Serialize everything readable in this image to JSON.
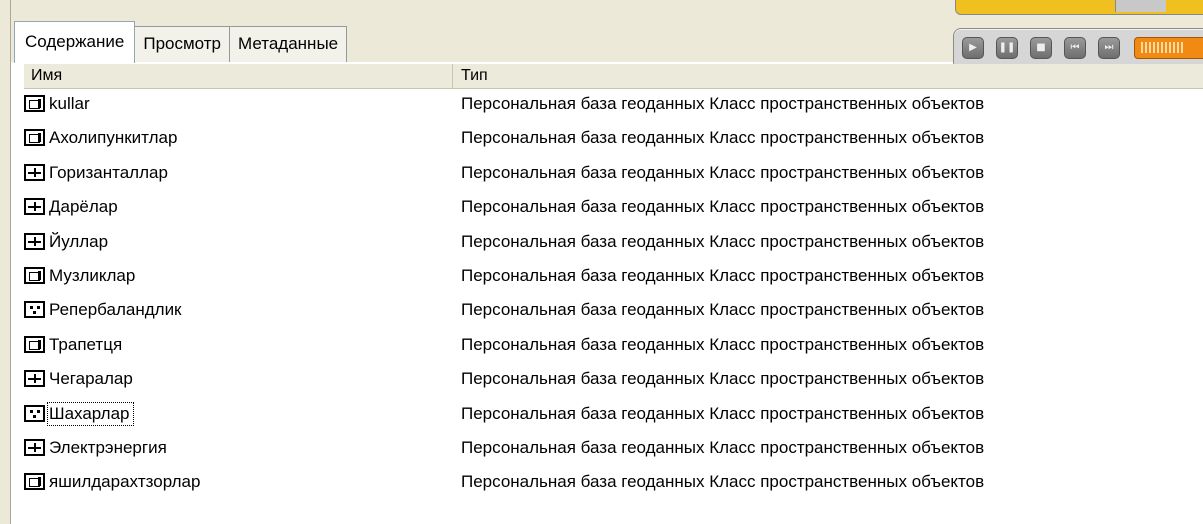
{
  "tabs": [
    {
      "label": "Содержание",
      "active": true
    },
    {
      "label": "Просмотр",
      "active": false
    },
    {
      "label": "Метаданные",
      "active": false
    }
  ],
  "media": {
    "buttons": [
      {
        "icon": "play-icon",
        "glyph": "▶"
      },
      {
        "icon": "pause-icon",
        "glyph": "❚❚"
      },
      {
        "icon": "stop-icon",
        "glyph": "■"
      },
      {
        "icon": "previous-icon",
        "glyph": "⏮"
      },
      {
        "icon": "next-icon",
        "glyph": "⏭"
      }
    ],
    "accent_color": "#f08a12"
  },
  "columns": {
    "name": "Имя",
    "type": "Тип"
  },
  "rows": [
    {
      "icon": "polygon-feature-class-icon",
      "kind": "poly",
      "name": "kullar",
      "type": "Персональная база геоданных Класс пространственных объектов"
    },
    {
      "icon": "polygon-feature-class-icon",
      "kind": "poly",
      "name": "Ахолипункитлар",
      "type": "Персональная база геоданных Класс пространственных объектов"
    },
    {
      "icon": "line-feature-class-icon",
      "kind": "line",
      "name": "Горизанталлар",
      "type": "Персональная база геоданных Класс пространственных объектов"
    },
    {
      "icon": "line-feature-class-icon",
      "kind": "line",
      "name": "Дарёлар",
      "type": "Персональная база геоданных Класс пространственных объектов"
    },
    {
      "icon": "line-feature-class-icon",
      "kind": "line",
      "name": "Йуллар",
      "type": "Персональная база геоданных Класс пространственных объектов"
    },
    {
      "icon": "polygon-feature-class-icon",
      "kind": "poly",
      "name": "Музликлар",
      "type": "Персональная база геоданных Класс пространственных объектов"
    },
    {
      "icon": "point-feature-class-icon",
      "kind": "point",
      "name": "Репербаландлик",
      "type": "Персональная база геоданных Класс пространственных объектов"
    },
    {
      "icon": "polygon-feature-class-icon",
      "kind": "poly",
      "name": "Трапетця",
      "type": "Персональная база геоданных Класс пространственных объектов"
    },
    {
      "icon": "line-feature-class-icon",
      "kind": "line",
      "name": "Чегаралар",
      "type": "Персональная база геоданных Класс пространственных объектов"
    },
    {
      "icon": "point-feature-class-icon",
      "kind": "point",
      "name": "Шахарлар",
      "type": "Персональная база геоданных Класс пространственных объектов",
      "selected": true
    },
    {
      "icon": "line-feature-class-icon",
      "kind": "line",
      "name": "Электрэнергия",
      "type": "Персональная база геоданных Класс пространственных объектов"
    },
    {
      "icon": "polygon-feature-class-icon",
      "kind": "poly",
      "name": "яшилдарахтзорлар",
      "type": "Персональная база геоданных Класс пространственных объектов"
    }
  ]
}
